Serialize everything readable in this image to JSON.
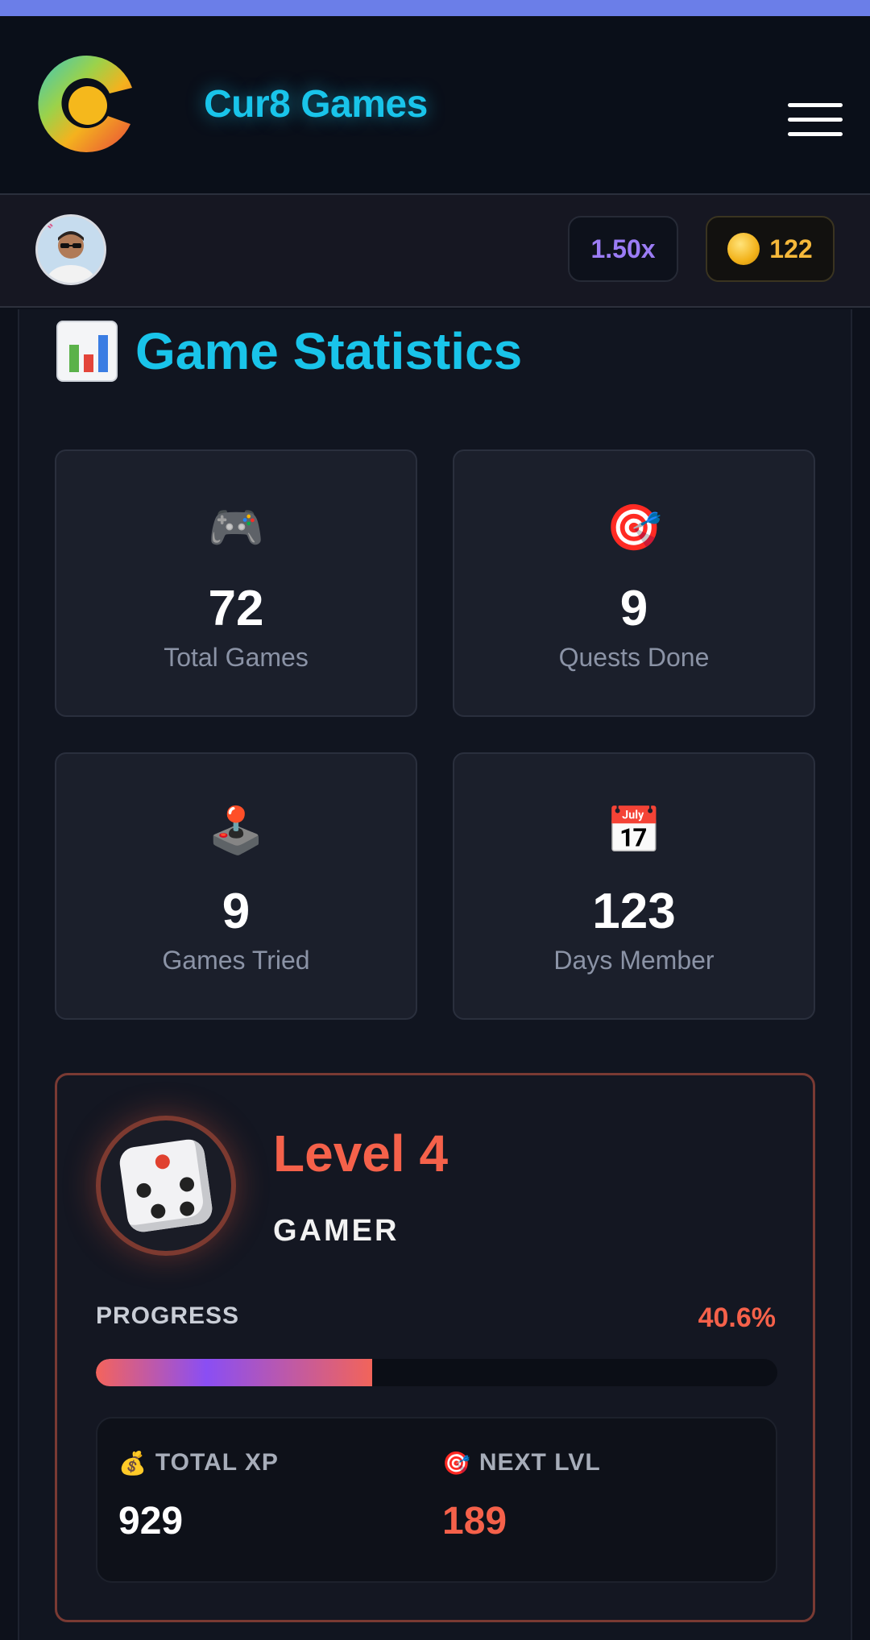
{
  "header": {
    "brand_name": "Cur8 Games",
    "menu_icon": "hamburger-menu-icon"
  },
  "userbar": {
    "multiplier": "1.50x",
    "coins": "122",
    "coin_icon": "gold-coin-icon"
  },
  "stats_section": {
    "title": "Game Statistics",
    "title_icon": "bar-chart-icon",
    "cards": [
      {
        "icon": "🎮",
        "icon_name": "gamepad-icon",
        "value": "72",
        "label": "Total Games"
      },
      {
        "icon": "🎯",
        "icon_name": "target-icon",
        "value": "9",
        "label": "Quests Done"
      },
      {
        "icon": "🕹️",
        "icon_name": "joystick-icon",
        "value": "9",
        "label": "Games Tried"
      },
      {
        "icon": "📅",
        "icon_name": "calendar-icon",
        "value": "123",
        "label": "Days Member"
      }
    ]
  },
  "level": {
    "title": "Level 4",
    "rank": "GAMER",
    "progress_label": "PROGRESS",
    "progress_text": "40.6%",
    "progress_value": 40.6,
    "total_xp_label": "TOTAL XP",
    "total_xp_icon": "💰",
    "total_xp_value": "929",
    "next_lvl_label": "NEXT LVL",
    "next_lvl_icon": "🎯",
    "next_lvl_value": "189"
  },
  "colors": {
    "accent_cyan": "#19c4ea",
    "accent_red": "#f5614a",
    "multiplier_purple": "#9b7cf5",
    "coins_gold": "#f5b83a"
  }
}
